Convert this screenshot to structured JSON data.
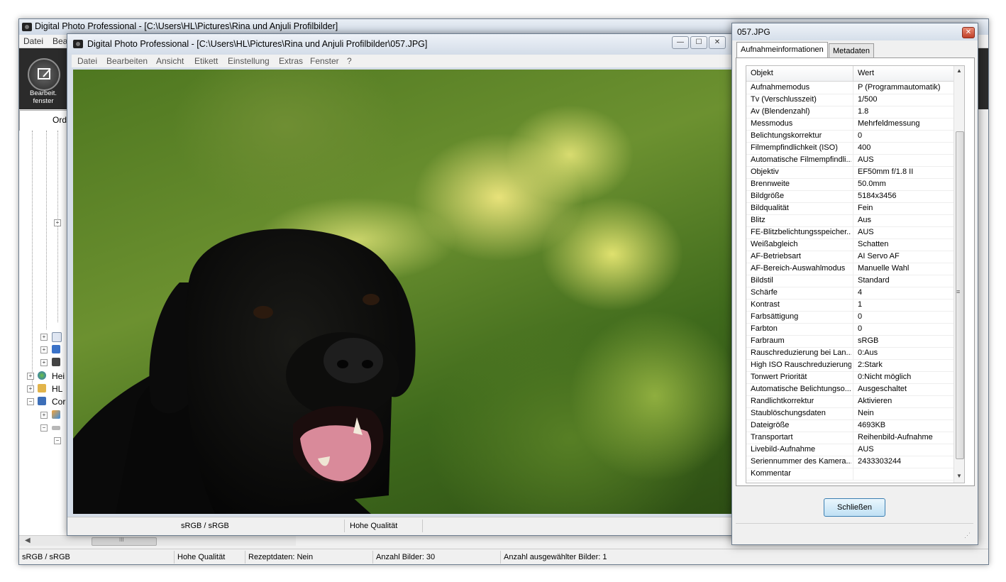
{
  "main_window": {
    "title": "Digital Photo Professional - [C:\\Users\\HL\\Pictures\\Rina und Anjuli Profilbilder]",
    "menu": [
      "Datei",
      "Bea"
    ],
    "toolbar": {
      "edit_window_label": "Bearbeit. fenster"
    },
    "ordner_label": "Ordı",
    "tree_items": [
      "Hei",
      "HL",
      "Cor"
    ],
    "hscroll_arrow_left": "◀",
    "hscroll_grip": "III",
    "status": {
      "color_space": "sRGB / sRGB",
      "quality": "Hohe Qualität",
      "recipe": "Rezeptdaten: Nein",
      "count": "Anzahl Bilder: 30",
      "selected": "Anzahl ausgewählter Bilder: 1"
    }
  },
  "image_window": {
    "title": "Digital Photo Professional - [C:\\Users\\HL\\Pictures\\Rina und Anjuli Profilbilder\\057.JPG]",
    "buttons": {
      "minimize": "—",
      "maximize": "☐",
      "close": "✕"
    },
    "menu": [
      "Datei",
      "Bearbeiten",
      "Ansicht",
      "Etikett",
      "Einstellung",
      "Extras",
      "Fenster",
      "?"
    ],
    "status": {
      "color_space": "sRGB / sRGB",
      "quality": "Hohe Qualität"
    }
  },
  "info_dialog": {
    "title": "057.JPG",
    "close_glyph": "✕",
    "tabs": [
      "Aufnahmeinformationen",
      "Metadaten"
    ],
    "headers": {
      "key": "Objekt",
      "value": "Wert"
    },
    "rows": [
      {
        "k": "Aufnahmemodus",
        "v": "P (Programmautomatik)"
      },
      {
        "k": "Tv (Verschlusszeit)",
        "v": "1/500"
      },
      {
        "k": "Av (Blendenzahl)",
        "v": "1.8"
      },
      {
        "k": "Messmodus",
        "v": "Mehrfeldmessung"
      },
      {
        "k": "Belichtungskorrektur",
        "v": "0"
      },
      {
        "k": "Filmempfindlichkeit (ISO)",
        "v": "400"
      },
      {
        "k": "Automatische Filmempfindli...",
        "v": "AUS"
      },
      {
        "k": "Objektiv",
        "v": "EF50mm f/1.8 II"
      },
      {
        "k": "Brennweite",
        "v": "50.0mm"
      },
      {
        "k": "Bildgröße",
        "v": "5184x3456"
      },
      {
        "k": "Bildqualität",
        "v": "Fein"
      },
      {
        "k": "Blitz",
        "v": "Aus"
      },
      {
        "k": "FE-Blitzbelichtungsspeicher...",
        "v": "AUS"
      },
      {
        "k": "Weißabgleich",
        "v": "Schatten"
      },
      {
        "k": "AF-Betriebsart",
        "v": "AI Servo AF"
      },
      {
        "k": "AF-Bereich-Auswahlmodus",
        "v": "Manuelle Wahl"
      },
      {
        "k": "Bildstil",
        "v": "Standard"
      },
      {
        "k": "Schärfe",
        "v": "4"
      },
      {
        "k": "Kontrast",
        "v": "1"
      },
      {
        "k": "Farbsättigung",
        "v": "0"
      },
      {
        "k": "Farbton",
        "v": "0"
      },
      {
        "k": "Farbraum",
        "v": "sRGB"
      },
      {
        "k": "Rauschreduzierung bei Lan...",
        "v": "0:Aus"
      },
      {
        "k": "High ISO Rauschreduzierung",
        "v": "2:Stark"
      },
      {
        "k": "Tonwert Priorität",
        "v": "0:Nicht möglich"
      },
      {
        "k": "Automatische Belichtungso...",
        "v": "Ausgeschaltet"
      },
      {
        "k": "Randlichtkorrektur",
        "v": "Aktivieren"
      },
      {
        "k": "Staublöschungsdaten",
        "v": "Nein"
      },
      {
        "k": "Dateigröße",
        "v": "4693KB"
      },
      {
        "k": "Transportart",
        "v": "Reihenbild-Aufnahme"
      },
      {
        "k": "Livebild-Aufnahme",
        "v": "AUS"
      },
      {
        "k": "Seriennummer des Kamera...",
        "v": "2433303244"
      },
      {
        "k": "Kommentar",
        "v": ""
      }
    ],
    "scroll": {
      "up": "▲",
      "down": "▼",
      "grip": "≡"
    },
    "close_button": "Schließen"
  },
  "colors": {
    "title_bar": "#d4dde9",
    "toolbar_dark": "#2b2b2b",
    "button_accent": "#3c7fb1",
    "dialog_close": "#c0412a"
  }
}
